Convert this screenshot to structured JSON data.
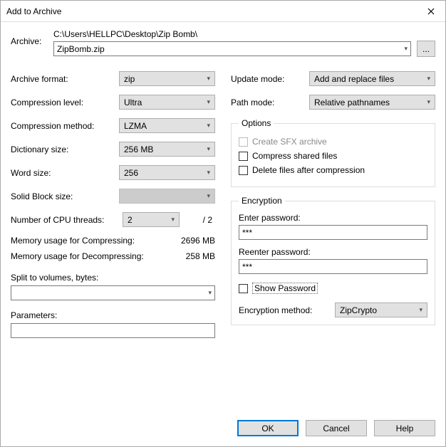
{
  "title": "Add to Archive",
  "archive": {
    "label": "Archive:",
    "path": "C:\\Users\\HELLPC\\Desktop\\Zip Bomb\\",
    "filename": "ZipBomb.zip",
    "browse": "..."
  },
  "left": {
    "format": {
      "label": "Archive format:",
      "value": "zip"
    },
    "level": {
      "label": "Compression level:",
      "value": "Ultra"
    },
    "method": {
      "label": "Compression method:",
      "value": "LZMA"
    },
    "dict": {
      "label": "Dictionary size:",
      "value": "256 MB"
    },
    "word": {
      "label": "Word size:",
      "value": "256"
    },
    "solid": {
      "label": "Solid Block size:",
      "value": ""
    },
    "cpu": {
      "label": "Number of CPU threads:",
      "value": "2",
      "total": "/ 2"
    },
    "mem_comp": {
      "label": "Memory usage for Compressing:",
      "value": "2696 MB"
    },
    "mem_decomp": {
      "label": "Memory usage for Decompressing:",
      "value": "258 MB"
    },
    "split": {
      "label": "Split to volumes, bytes:",
      "value": ""
    },
    "params": {
      "label": "Parameters:",
      "value": ""
    }
  },
  "right": {
    "update": {
      "label": "Update mode:",
      "value": "Add and replace files"
    },
    "pathmode": {
      "label": "Path mode:",
      "value": "Relative pathnames"
    },
    "options": {
      "legend": "Options",
      "sfx": "Create SFX archive",
      "shared": "Compress shared files",
      "delete": "Delete files after compression"
    },
    "encryption": {
      "legend": "Encryption",
      "enter": "Enter password:",
      "reenter": "Reenter password:",
      "mask": "***",
      "show": "Show Password",
      "method_label": "Encryption method:",
      "method_value": "ZipCrypto"
    }
  },
  "buttons": {
    "ok": "OK",
    "cancel": "Cancel",
    "help": "Help"
  }
}
